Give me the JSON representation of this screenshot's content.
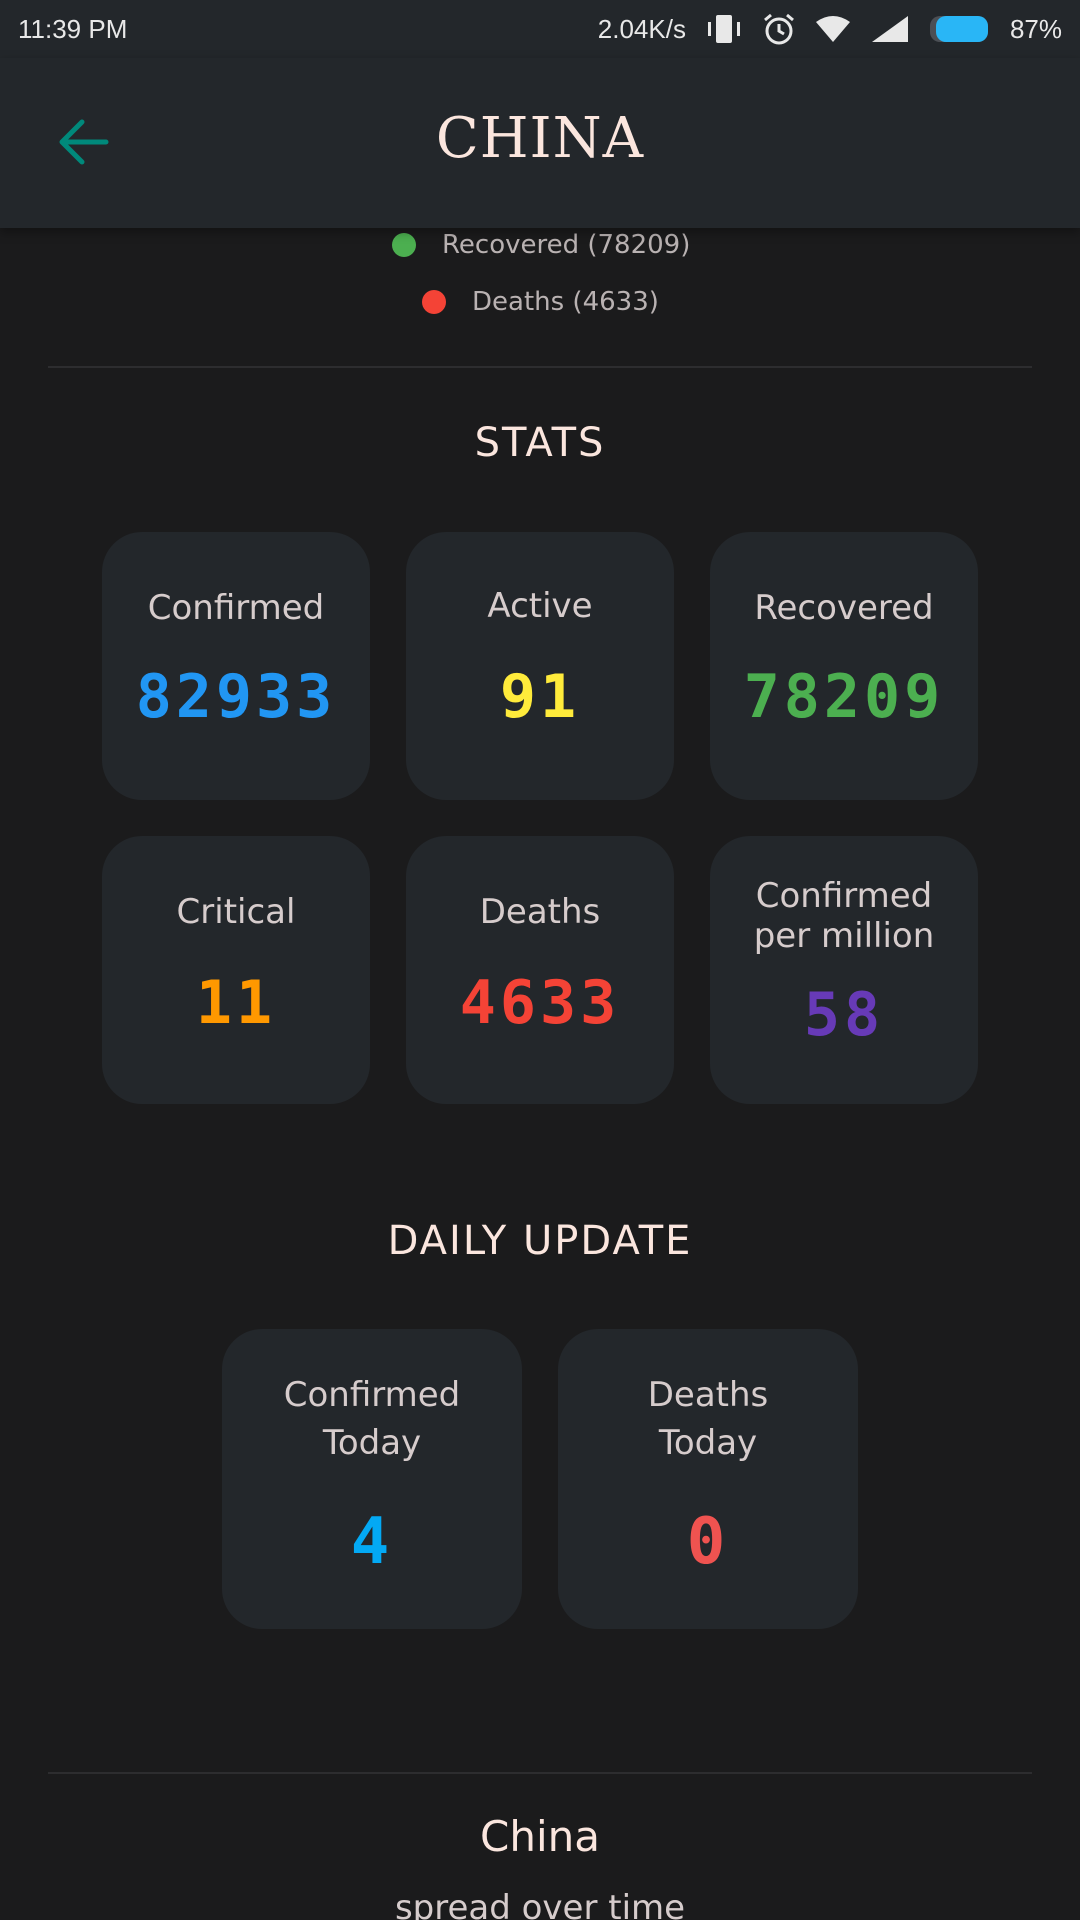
{
  "status_bar": {
    "time": "11:39 PM",
    "network_speed": "2.04K/s",
    "battery": "87%",
    "battery_level": 0.87,
    "icons": [
      "vibrate-icon",
      "alarm-icon",
      "wifi-icon",
      "signal-icon",
      "battery-icon"
    ]
  },
  "app_bar": {
    "title": "CHINA",
    "back_icon": "arrow-left-icon"
  },
  "legend": {
    "items": [
      {
        "label": "Recovered (78209)",
        "color": "#4caf50"
      },
      {
        "label": "Deaths (4633)",
        "color": "#f44336"
      }
    ]
  },
  "stats": {
    "title": "STATS",
    "cards": [
      {
        "label": "Confirmed",
        "value": "82933",
        "color": "#2196f3"
      },
      {
        "label": "Active",
        "value": "91",
        "color": "#ffeb3b"
      },
      {
        "label": "Recovered",
        "value": "78209",
        "color": "#4caf50"
      },
      {
        "label": "Critical",
        "value": "11",
        "color": "#ff9800"
      },
      {
        "label": "Deaths",
        "value": "4633",
        "color": "#f44336"
      },
      {
        "label": "Confirmed per million",
        "value": "58",
        "color": "#673ab7"
      }
    ]
  },
  "daily_update": {
    "title": "DAILY UPDATE",
    "cards": [
      {
        "label": "Confirmed Today",
        "value": "4",
        "color": "#03a9f4"
      },
      {
        "label": "Deaths Today",
        "value": "0",
        "color": "#ef5350"
      }
    ]
  },
  "spread": {
    "title": "China",
    "subtitle": "spread over time"
  },
  "colors": {
    "background": "#1b1b1c",
    "card": "#23272b",
    "accent": "#00897b",
    "title_text": "#fbe6de"
  }
}
